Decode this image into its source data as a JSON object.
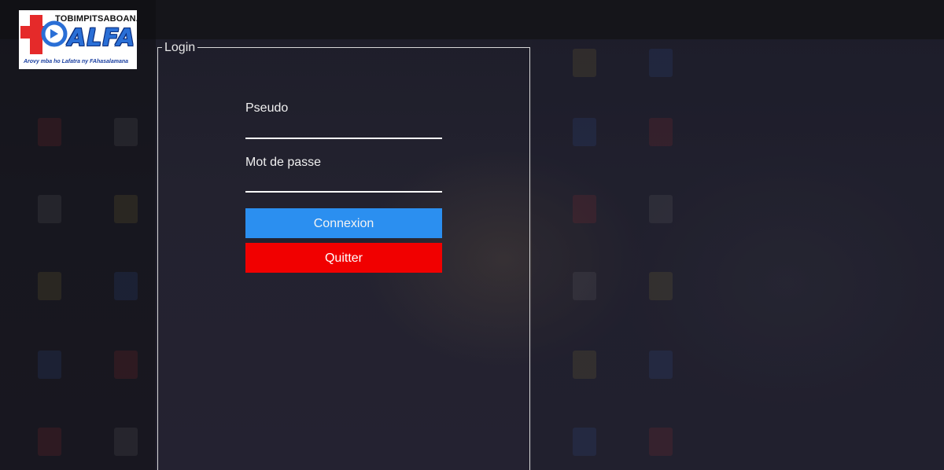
{
  "logo": {
    "topline": "TOBIMPITSABOANA",
    "brand": "ALFA",
    "tagline": "Arovy mba ho Lafatra ny FAhasalamana",
    "colors": {
      "red": "#e52a2a",
      "blue": "#2a6fd6",
      "navy": "#0b2c7a"
    }
  },
  "login": {
    "group_title": "Login",
    "pseudo_label": "Pseudo",
    "pseudo_value": "",
    "password_label": "Mot de passe",
    "password_value": "",
    "connect_label": "Connexion",
    "quit_label": "Quitter"
  },
  "colors": {
    "connect_button": "#2b8ff0",
    "quit_button": "#f10000"
  }
}
